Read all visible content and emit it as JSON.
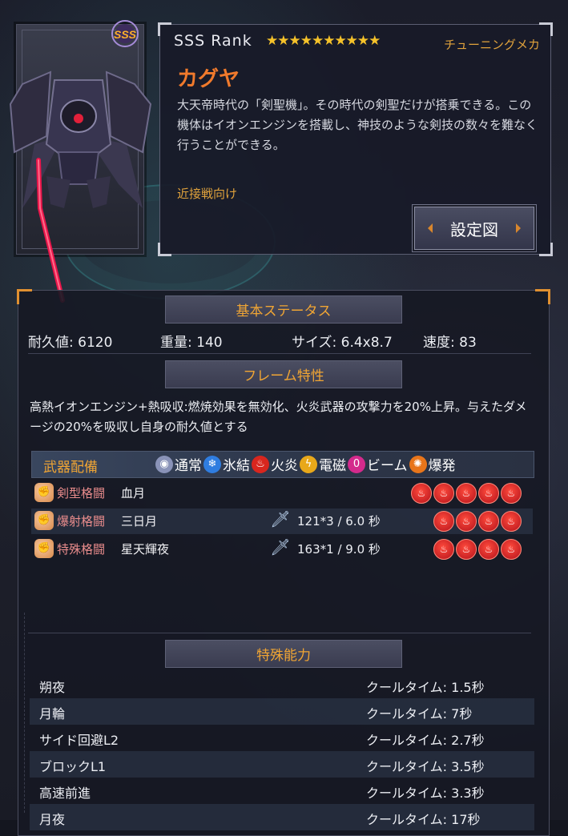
{
  "unit": {
    "rank": "SSS Rank",
    "rank_badge": "SSS",
    "stars": "★★★★★★★★★★",
    "type_label": "チューニングメカ",
    "name": "カグヤ",
    "description": "大天帝時代の「剣聖機」。その時代の剣聖だけが搭乗できる。この機体はイオンエンジンを搭載し、神技のような剣技の数々を難なく行うことができる。",
    "role": "近接戦向け",
    "settings_button": "設定図"
  },
  "basic_status": {
    "header": "基本ステータス",
    "stats": [
      {
        "label": "耐久値:",
        "value": "6120"
      },
      {
        "label": "重量:",
        "value": "140"
      },
      {
        "label": "サイズ:",
        "value": "6.4x8.7"
      },
      {
        "label": "速度:",
        "value": "83"
      }
    ]
  },
  "frame_trait": {
    "header": "フレーム特性",
    "text": "高熱イオンエンジン+熱吸収:燃焼効果を無効化、火炎武器の攻撃力を20%上昇。与えたダメージの20%を吸収し自身の耐久値とする"
  },
  "weapons": {
    "header": "武器配備",
    "legend": [
      {
        "label": "通常",
        "icon": "normal-icon",
        "color": "#8a93b8"
      },
      {
        "label": "氷結",
        "icon": "ice-icon",
        "color": "#2f7de0"
      },
      {
        "label": "火炎",
        "icon": "fire-icon",
        "color": "#d8261e"
      },
      {
        "label": "電磁",
        "icon": "lightning-icon",
        "color": "#e8a81a"
      },
      {
        "label": "ビーム",
        "icon": "beam-icon",
        "color": "#d42a8c"
      },
      {
        "label": "爆発",
        "icon": "explosion-icon",
        "color": "#e8751a"
      }
    ],
    "items": [
      {
        "category": "剣型格闘",
        "name": "血月",
        "damage": "",
        "fire_count": 5
      },
      {
        "category": "爆射格闘",
        "name": "三日月",
        "damage": "121*3 / 6.0 秒",
        "fire_count": 4
      },
      {
        "category": "特殊格闘",
        "name": "星天輝夜",
        "damage": "163*1 / 9.0 秒",
        "fire_count": 4
      }
    ]
  },
  "abilities": {
    "header": "特殊能力",
    "items": [
      {
        "name": "朔夜",
        "cooldown": "クールタイム: 1.5秒"
      },
      {
        "name": "月輪",
        "cooldown": "クールタイム: 7秒"
      },
      {
        "name": "サイド回避L2",
        "cooldown": "クールタイム: 2.7秒"
      },
      {
        "name": "ブロックL1",
        "cooldown": "クールタイム: 3.5秒"
      },
      {
        "name": "高速前進",
        "cooldown": "クールタイム: 3.3秒"
      },
      {
        "name": "月夜",
        "cooldown": "クールタイム: 17秒"
      }
    ]
  }
}
